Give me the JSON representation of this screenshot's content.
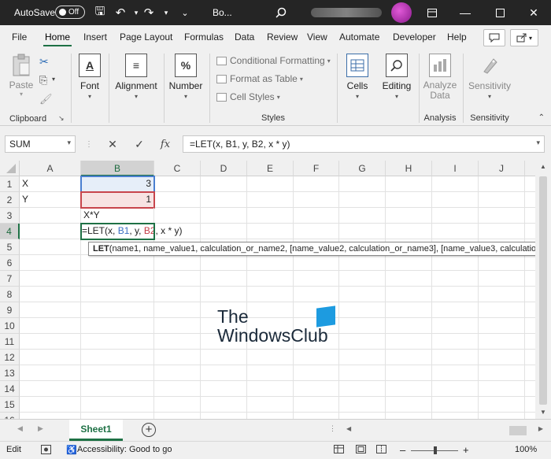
{
  "titlebar": {
    "autosave_label": "AutoSave",
    "autosave_state": "Off",
    "doc_title": "Bo...",
    "icons": [
      "save-icon",
      "undo-icon",
      "redo-icon",
      "customize-icon",
      "search-icon",
      "ribbon-display-icon",
      "minimize-icon",
      "maximize-icon",
      "close-icon"
    ]
  },
  "tabs": [
    "File",
    "Home",
    "Insert",
    "Page Layout",
    "Formulas",
    "Data",
    "Review",
    "View",
    "Automate",
    "Developer",
    "Help"
  ],
  "ribbon": {
    "clipboard": {
      "paste": "Paste",
      "label": "Clipboard"
    },
    "font": {
      "label": "Font"
    },
    "alignment": {
      "label": "Alignment"
    },
    "number": {
      "label": "Number"
    },
    "styles": {
      "conditional": "Conditional Formatting",
      "format_table": "Format as Table",
      "cell_styles": "Cell Styles",
      "label": "Styles"
    },
    "cells": {
      "label": "Cells"
    },
    "editing": {
      "label": "Editing"
    },
    "analysis": {
      "analyze_data_line1": "Analyze",
      "analyze_data_line2": "Data",
      "label": "Analysis"
    },
    "sensitivity": {
      "btn": "Sensitivity",
      "label": "Sensitivity"
    }
  },
  "formula_bar": {
    "name_box": "SUM",
    "cancel_glyph": "✕",
    "enter_glyph": "✓",
    "fx_glyph": "fx",
    "formula": "=LET(x, B1, y, B2, x * y)"
  },
  "columns": [
    "A",
    "B",
    "C",
    "D",
    "E",
    "F",
    "G",
    "H",
    "I",
    "J"
  ],
  "rows": [
    "1",
    "2",
    "3",
    "4",
    "5",
    "6",
    "7",
    "8",
    "9",
    "10",
    "11",
    "12",
    "13",
    "14",
    "15",
    "16"
  ],
  "cells": {
    "A1": "X",
    "A2": "Y",
    "B1": "3",
    "B2": "1",
    "B3": "X*Y",
    "B4": {
      "p1": "=LET(x, ",
      "p2": "B1",
      "p3": ", y, ",
      "p4": "B2",
      "p5": ", x * y)"
    }
  },
  "tooltip": {
    "fn": "LET",
    "args": "(name1, name_value1, calculation_or_name2, [name_value2, calculation_or_name3], [name_value3, calculation_or_na"
  },
  "watermark": {
    "line1": "The",
    "line2": "WindowsClub"
  },
  "sheets": [
    "Sheet1"
  ],
  "status": {
    "mode": "Edit",
    "accessibility": "Accessibility: Good to go",
    "zoom": "100%"
  }
}
